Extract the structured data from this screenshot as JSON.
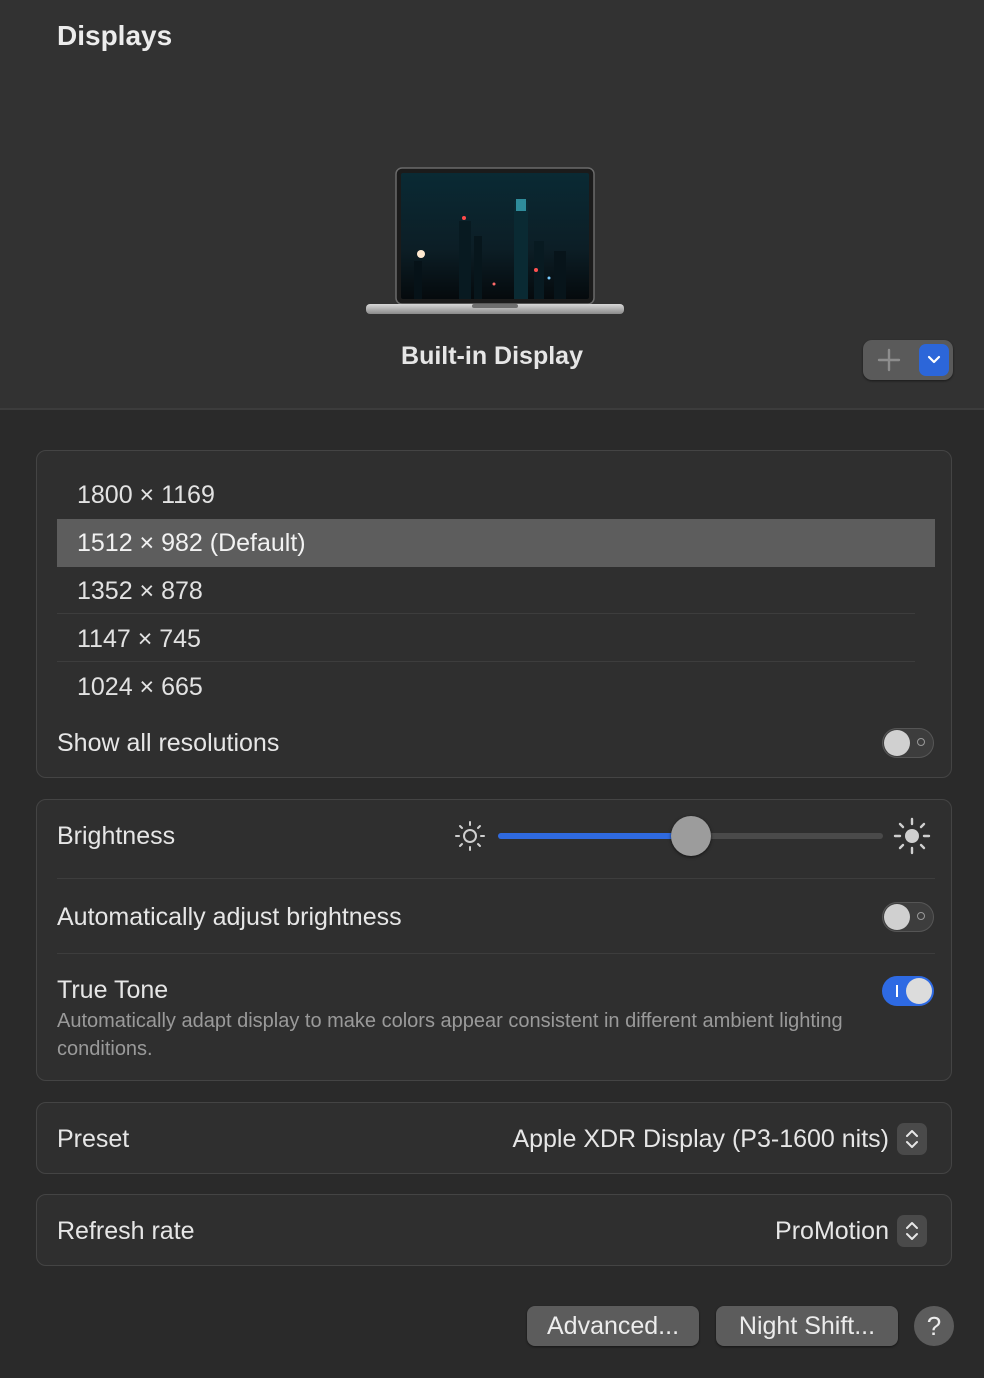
{
  "window": {
    "title": "Displays"
  },
  "display": {
    "name": "Built-in Display"
  },
  "resolutions": {
    "items": [
      {
        "label": "1800 × 1169",
        "selected": false
      },
      {
        "label": "1512 × 982 (Default)",
        "selected": true
      },
      {
        "label": "1352 × 878",
        "selected": false
      },
      {
        "label": "1147 × 745",
        "selected": false
      },
      {
        "label": "1024 × 665",
        "selected": false
      }
    ],
    "show_all_label": "Show all resolutions",
    "show_all_on": false
  },
  "brightness": {
    "label": "Brightness",
    "level": 0.5,
    "auto_label": "Automatically adjust brightness",
    "auto_on": false
  },
  "true_tone": {
    "label": "True Tone",
    "description": "Automatically adapt display to make colors appear consistent in different ambient lighting conditions.",
    "on": true
  },
  "preset": {
    "label": "Preset",
    "value": "Apple XDR Display (P3-1600 nits)"
  },
  "refresh_rate": {
    "label": "Refresh rate",
    "value": "ProMotion"
  },
  "buttons": {
    "advanced": "Advanced...",
    "night_shift": "Night Shift...",
    "help": "?"
  },
  "colors": {
    "accent": "#2f6ae0",
    "selected_row": "#5d5d5d"
  }
}
